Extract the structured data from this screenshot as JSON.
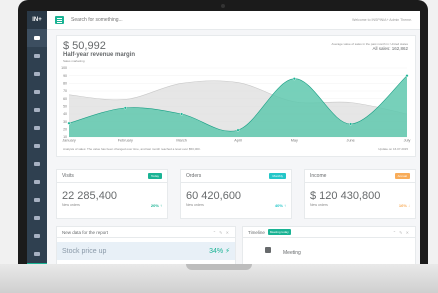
{
  "app": {
    "logo": "IN+",
    "search_placeholder": "Search for something...",
    "welcome": "Welcome to INSPINIA+ Admin Theme."
  },
  "summary": {
    "value": "$ 50,992",
    "title": "Half-year revenue margin",
    "subtitle": "Sales marketing",
    "avg_text": "Average value of sales in the past month in: United states",
    "all_sales": "All sales: 162,862",
    "analysis": "Analysis of sales: The value has been changed over time, and last month reached a level over $50,000.",
    "updated": "Update on 16.07.2015"
  },
  "colors": {
    "accent": "#1ab394",
    "sidebar": "#2f4050",
    "area_primary": "#5fc8ae",
    "area_secondary": "#dcdcdc",
    "warning": "#f8ac59",
    "info": "#23c6c8"
  },
  "chart_data": {
    "type": "area",
    "categories": [
      "January",
      "February",
      "March",
      "April",
      "May",
      "June",
      "July"
    ],
    "ylim": [
      10,
      100
    ],
    "yticks": [
      10,
      20,
      30,
      40,
      50,
      60,
      70,
      80,
      90,
      100
    ],
    "series": [
      {
        "values": [
          65,
          59,
          80,
          81,
          56,
          55,
          40
        ]
      },
      {
        "values": [
          28,
          48,
          40,
          19,
          86,
          27,
          90
        ]
      }
    ]
  },
  "stats": [
    {
      "title": "Visits",
      "badge": "Today",
      "badge_color": "#1ab394",
      "value": "22 285,400",
      "sub": "New orders",
      "pct": "20% ↑",
      "pct_color": "#1ab394"
    },
    {
      "title": "Orders",
      "badge": "Monthly",
      "badge_color": "#23c6c8",
      "value": "60 420,600",
      "sub": "New orders",
      "pct": "40% ↑",
      "pct_color": "#23c6c8"
    },
    {
      "title": "Income",
      "badge": "Annual",
      "badge_color": "#f8ac59",
      "value": "$ 120 430,800",
      "sub": "New orders",
      "pct": "16% ↓",
      "pct_color": "#f8ac59"
    }
  ],
  "bottom": {
    "report_title": "New data for the report",
    "stock_label": "Stock price up",
    "stock_pct": "34%",
    "timeline_title": "Timeline",
    "timeline_badge": "Meeting today",
    "timeline_item": "Meeting"
  },
  "sidebar_icons": [
    "dashboard-icon",
    "chart-icon",
    "mail-icon",
    "user-icon",
    "edit-icon",
    "desktop-icon",
    "files-icon",
    "flask-icon",
    "laptop-icon",
    "table-icon",
    "image-icon",
    "sitemap-icon",
    "magic-icon",
    "star-icon"
  ]
}
